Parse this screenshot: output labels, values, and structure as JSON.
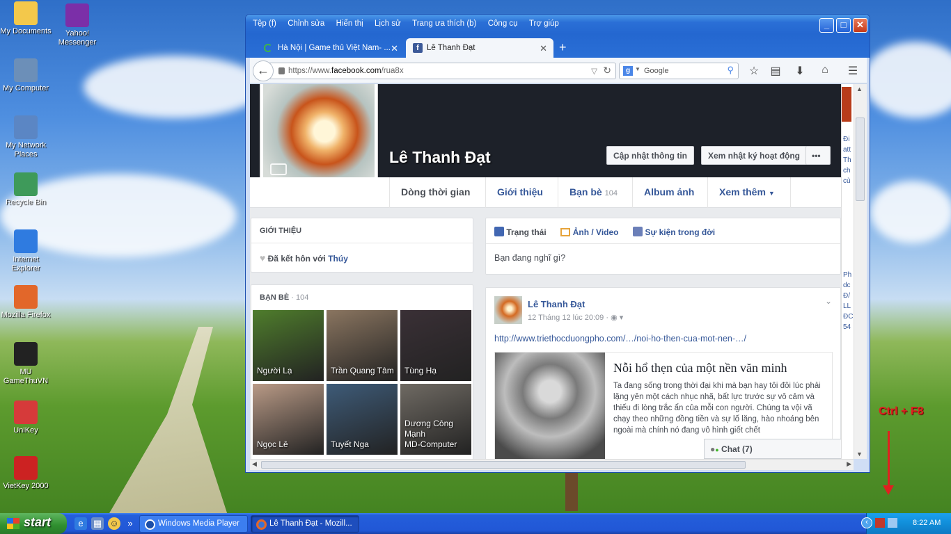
{
  "desktop": {
    "icons": [
      {
        "label": "My Documents",
        "icon": "folder-documents-icon",
        "color": "#f3c84b"
      },
      {
        "label": "Yahoo!\nMessenger",
        "icon": "yahoo-messenger-icon",
        "color": "#7b2fa8"
      },
      {
        "label": "My Computer",
        "icon": "computer-icon",
        "color": "#6c8fb8"
      },
      {
        "label": "My Network\nPlaces",
        "icon": "network-icon",
        "color": "#5b86c4"
      },
      {
        "label": "Recycle Bin",
        "icon": "recycle-bin-icon",
        "color": "#3e9a5a"
      },
      {
        "label": "Internet\nExplorer",
        "icon": "internet-explorer-icon",
        "color": "#2f7be0"
      },
      {
        "label": "Mozilla Firefox",
        "icon": "firefox-icon",
        "color": "#e2672a"
      },
      {
        "label": "MU\nGameThuVN",
        "icon": "mu-game-icon",
        "color": "#222222"
      },
      {
        "label": "UniKey",
        "icon": "unikey-icon",
        "color": "#d63a3a"
      },
      {
        "label": "VietKey 2000",
        "icon": "vietkey-icon",
        "color": "#cc2222"
      }
    ],
    "overlay_text": "Ctrl + F8"
  },
  "taskbar": {
    "start_label": "start",
    "buttons": [
      {
        "label": "Windows Media Player"
      },
      {
        "label": "Lê Thanh Đạt - Mozill..."
      }
    ],
    "clock": "8:22 AM"
  },
  "browser": {
    "menu": [
      "Tệp (f)",
      "Chỉnh sửa",
      "Hiển thị",
      "Lịch sử",
      "Trang ưa thích (b)",
      "Công cụ",
      "Trợ giúp"
    ],
    "tabs": [
      {
        "title": "Hà Nội | Game thủ Việt Nam- ..."
      },
      {
        "title": "Lê Thanh Đạt"
      }
    ],
    "url_prefix": "https://www.",
    "url_domain": "facebook.com",
    "url_path": "/rua8x",
    "search_placeholder": "Google"
  },
  "profile": {
    "name": "Lê Thanh Đạt",
    "update_info_button": "Cập nhật thông tin",
    "activity_log_button": "Xem nhật ký hoạt động",
    "more_button": "•••",
    "nav": {
      "timeline": "Dòng thời gian",
      "about": "Giới thiệu",
      "friends": "Bạn bè",
      "friends_count": "104",
      "photos": "Album ảnh",
      "more": "Xem thêm"
    },
    "intro": {
      "header": "GIỚI THIỆU",
      "status_prefix": "Đã kết hôn với ",
      "spouse": "Thúy"
    },
    "friends": {
      "header": "BẠN BÈ",
      "count": "· 104",
      "list": [
        {
          "name": "Người Lạ",
          "color": "#4f7d2c"
        },
        {
          "name": "Trần Quang Tâm",
          "color": "#8a7560"
        },
        {
          "name": "Tùng Hạ",
          "color": "#3a3036"
        },
        {
          "name": "Ngọc Lê",
          "color": "#b99a86"
        },
        {
          "name": "Tuyết Nga",
          "color": "#3e5b78"
        },
        {
          "name": "Dương Công\nMạnh\nMD-Computer",
          "color": "#6f6a63"
        }
      ]
    },
    "composer": {
      "status_tab": "Trạng thái",
      "photo_tab": "Ảnh / Video",
      "event_tab": "Sự kiện trong đời",
      "placeholder": "Bạn đang nghĩ gì?"
    },
    "post": {
      "author": "Lê Thanh Đạt",
      "time": "12 Tháng 12 lúc 20:09 ·",
      "link": "http://www.triethocduongpho.com/…/noi-ho-then-cua-mot-nen-…/",
      "card_title": "Nỗi hổ thẹn của một nền văn minh",
      "card_text": "Ta đang sống trong thời đại khi mà bạn hay tôi đôi lúc phải lặng yên một cách nhục nhã, bất lực trước sự vô cảm và thiếu đi lòng trắc ẩn của mỗi con người. Chúng ta vội vã chạy theo những đồng tiền và sự lố lăng, hào nhoáng bên ngoài mà chính nó đang vô hình giết chết"
    },
    "chat": "Chat (7)",
    "ticker_snippets": [
      "Đi",
      "att",
      "Th",
      "ch",
      "cù",
      "Ph",
      "dc",
      "Đ/",
      "LL",
      "ĐC",
      "54"
    ]
  },
  "colors": {
    "fb_blue": "#365899",
    "xp_blue": "#245edb",
    "overlay_red": "#e02020"
  }
}
